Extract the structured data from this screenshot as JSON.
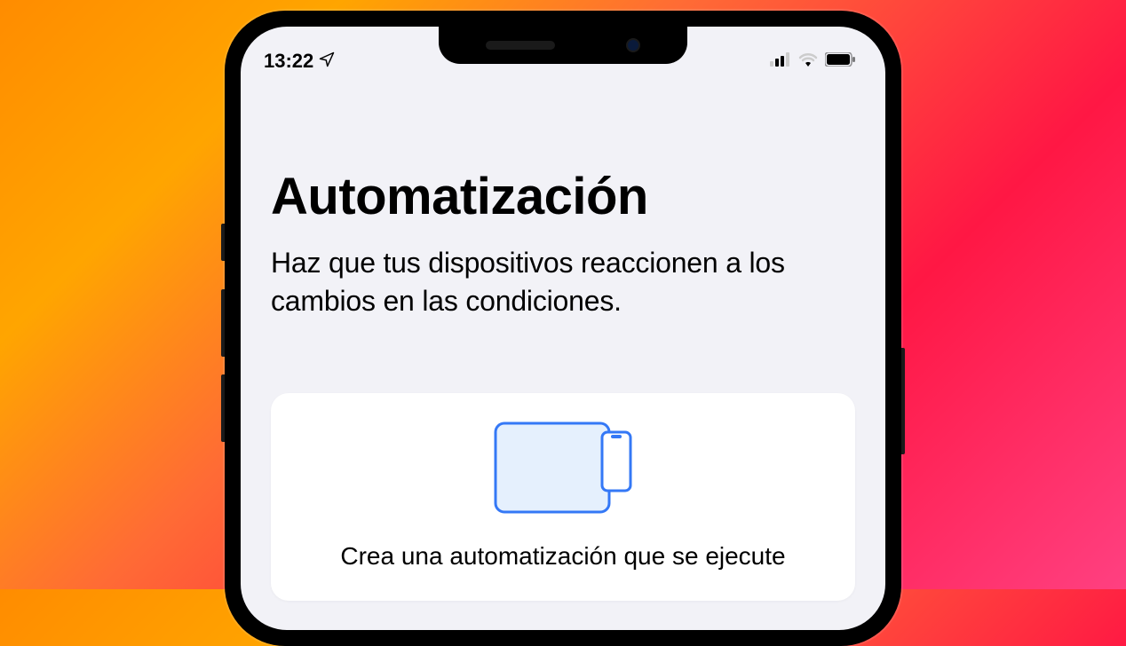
{
  "statusBar": {
    "time": "13:22"
  },
  "header": {
    "title": "Automatización",
    "subtitle": "Haz que tus dispositivos reaccionen a los cambios en las condiciones."
  },
  "card": {
    "description": "Crea una automatización que se ejecute"
  }
}
